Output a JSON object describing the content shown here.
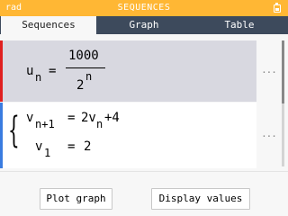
{
  "status": {
    "mode": "rad",
    "title": "SEQUENCES"
  },
  "tabs": [
    {
      "label": "Sequences",
      "active": true
    },
    {
      "label": "Graph",
      "active": false
    },
    {
      "label": "Table",
      "active": false
    }
  ],
  "sequences": [
    {
      "color": "#e02020",
      "lhs_name": "u",
      "lhs_index": "n",
      "equals": "=",
      "numerator": "1000",
      "denominator_base": "2",
      "denominator_exponent": "n",
      "menu": "..."
    },
    {
      "color": "#3a7ce0",
      "recurrence": {
        "lhs_name": "v",
        "lhs_index": "n+1",
        "equals": "=",
        "rhs_prefix": "2v",
        "rhs_index": "n",
        "rhs_suffix": "+4"
      },
      "initial": {
        "lhs_name": "v",
        "lhs_index": "1",
        "equals": "=",
        "value": "2"
      },
      "menu": "..."
    }
  ],
  "buttons": {
    "plot": "Plot graph",
    "values": "Display values"
  },
  "colors": {
    "status_bar": "#ffb734",
    "tab_bar": "#3d4a5c",
    "selected_row": "#d8d8e0"
  }
}
